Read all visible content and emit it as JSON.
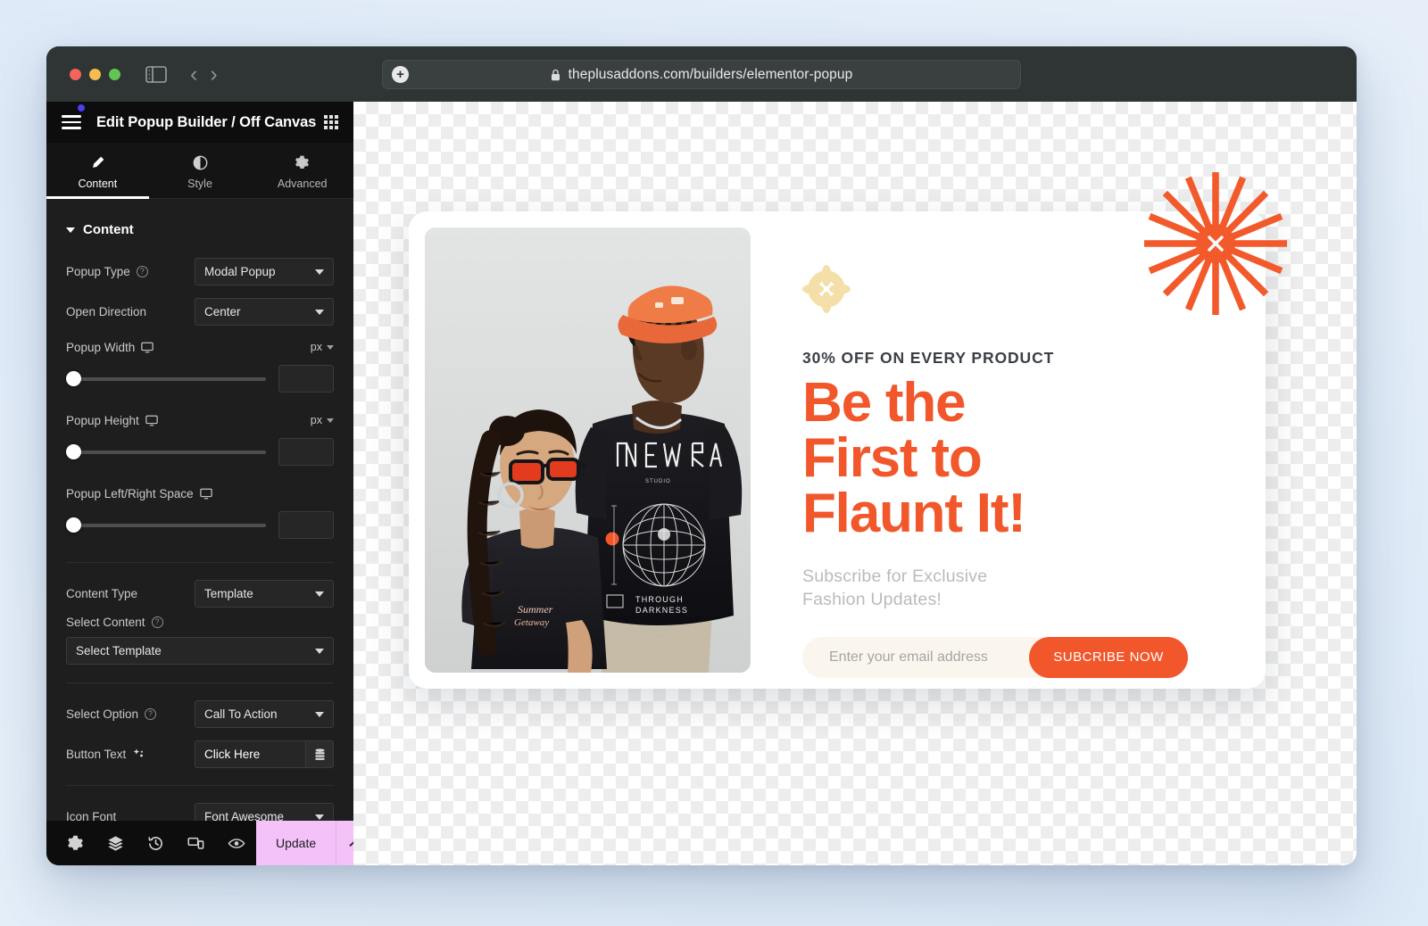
{
  "browser": {
    "url": "theplusaddons.com/builders/elementor-popup",
    "lock_icon": "lock-icon",
    "new_tab_icon": "plus-icon",
    "sidebar_icon": "sidebar-toggle-icon",
    "back_icon": "chevron-left-icon",
    "forward_icon": "chevron-right-icon",
    "traffic_lights": [
      "close-red",
      "minimize-yellow",
      "maximize-green"
    ]
  },
  "panel": {
    "title": "Edit Popup Builder / Off Canvas",
    "menu_icon": "hamburger-icon",
    "apps_icon": "grid-apps-icon",
    "tabs": [
      {
        "label": "Content",
        "icon": "pencil-icon",
        "active": true
      },
      {
        "label": "Style",
        "icon": "contrast-icon",
        "active": false
      },
      {
        "label": "Advanced",
        "icon": "gear-icon",
        "active": false
      }
    ],
    "section": {
      "title": "Content",
      "caret": "caret-down-icon"
    },
    "controls": {
      "popup_type": {
        "label": "Popup Type",
        "value": "Modal Popup",
        "help": true
      },
      "open_direction": {
        "label": "Open Direction",
        "value": "Center",
        "help": false
      },
      "popup_width": {
        "label": "Popup Width",
        "unit": "px",
        "value": "",
        "device": "desktop-icon"
      },
      "popup_height": {
        "label": "Popup Height",
        "unit": "px",
        "value": "",
        "device": "desktop-icon"
      },
      "popup_lr_space": {
        "label": "Popup Left/Right Space",
        "unit": "",
        "value": "",
        "device": "desktop-icon"
      },
      "content_type": {
        "label": "Content Type",
        "value": "Template",
        "help": false
      },
      "select_content": {
        "label": "Select Content",
        "value": "Select Template",
        "help": true
      },
      "select_option": {
        "label": "Select Option",
        "value": "Call To Action",
        "help": true
      },
      "button_text": {
        "label": "Button Text",
        "value": "Click Here",
        "ai_icon": "sparkle-icon",
        "dynamic_icon": "database-icon"
      },
      "icon_font": {
        "label": "Icon Font",
        "value": "Font Awesome",
        "help": false
      }
    },
    "footer": {
      "icons": [
        "gear-icon",
        "layers-icon",
        "history-icon",
        "responsive-icon",
        "preview-eye-icon"
      ],
      "update_label": "Update",
      "update_chevron": "chevron-up-icon",
      "update_color": "#f4c2f9"
    }
  },
  "popup": {
    "close_icon": "starburst-close-icon",
    "decoration_icon": "flower-asterisk-icon",
    "eyebrow": "30% OFF ON EVERY PRODUCT",
    "headline_lines": [
      "Be the",
      "First to",
      "Flaunt It!"
    ],
    "subhead_lines": [
      "Subscribe for Exclusive",
      "Fashion Updates!"
    ],
    "email_placeholder": "Enter your email address",
    "subscribe_label": "SUBCRIBE NOW",
    "image_alt": "two-fashion-models-photo",
    "colors": {
      "accent_orange": "#f1572a",
      "cream": "#fbf6ed",
      "flower": "#f4dfa8",
      "subhead_gray": "#b9bbbe",
      "eyebrow_dark": "#3b3f45"
    }
  }
}
